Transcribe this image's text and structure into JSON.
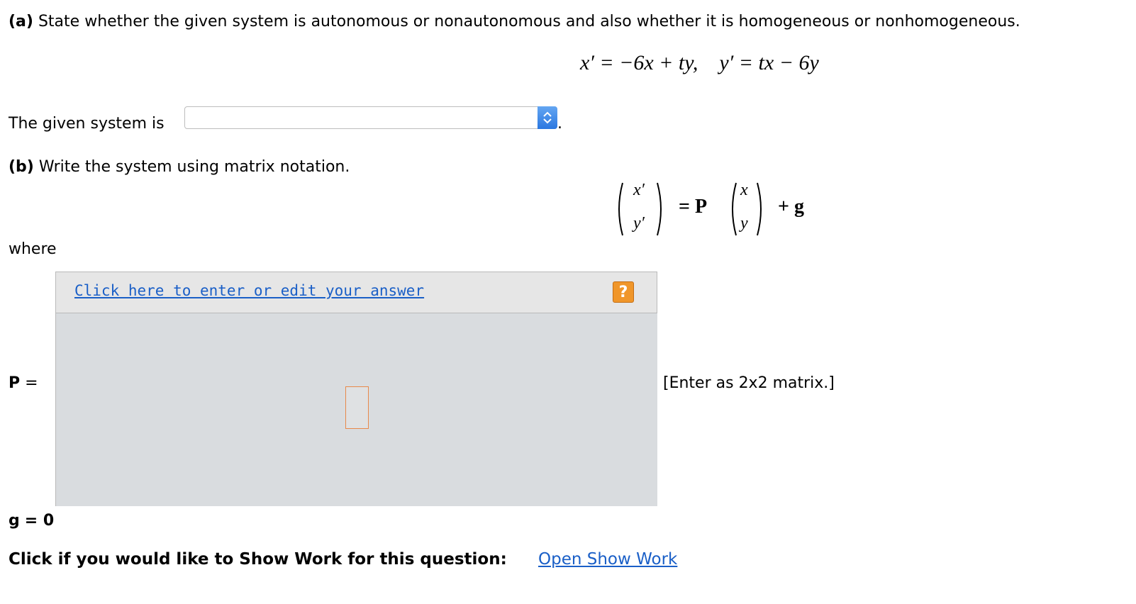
{
  "part_a": {
    "label": "(a)",
    "text": "State whether the given system is autonomous or nonautonomous and also whether it is homogeneous or nonhomogeneous.",
    "equation": "x′ = −6x + ty,    y′ = tx − 6y",
    "answer_prefix": "The given system is",
    "select_value": "",
    "answer_suffix": "."
  },
  "part_b": {
    "label": "(b)",
    "text": "Write the system using matrix notation.",
    "eq_top_left": "x′",
    "eq_bottom_left": "y′",
    "eq_equals_p": "= P",
    "eq_top_right": "x",
    "eq_bottom_right": "y",
    "eq_plus_g": "+ g",
    "where": "where",
    "p_label": "P",
    "p_equals": "=",
    "editor_link": "Click here to enter or edit your answer",
    "help": "?",
    "matrix_hint": "[Enter as 2x2 matrix.]",
    "g_label": "g",
    "g_value": "= 0"
  },
  "show_work": {
    "prompt": "Click if you would like to Show Work for this question:",
    "link": "Open Show Work"
  }
}
